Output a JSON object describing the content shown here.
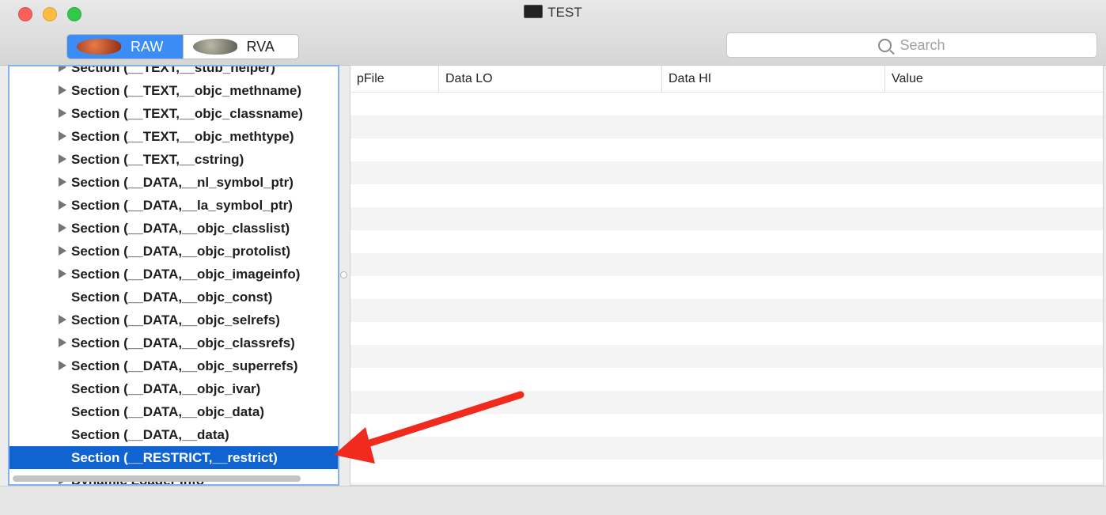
{
  "window": {
    "title": "TEST",
    "icon": "terminal-icon"
  },
  "toolbar": {
    "mode_selector": [
      {
        "label": "RAW",
        "icon": "raw-mode-icon",
        "active": true
      },
      {
        "label": "RVA",
        "icon": "rva-mode-icon",
        "active": false
      }
    ],
    "search_placeholder": "Search"
  },
  "tree": {
    "items": [
      {
        "label": "Section (__TEXT,__stub_helper)",
        "expandable": true
      },
      {
        "label": "Section (__TEXT,__objc_methname)",
        "expandable": true
      },
      {
        "label": "Section (__TEXT,__objc_classname)",
        "expandable": true
      },
      {
        "label": "Section (__TEXT,__objc_methtype)",
        "expandable": true
      },
      {
        "label": "Section (__TEXT,__cstring)",
        "expandable": true
      },
      {
        "label": "Section (__DATA,__nl_symbol_ptr)",
        "expandable": true
      },
      {
        "label": "Section (__DATA,__la_symbol_ptr)",
        "expandable": true
      },
      {
        "label": "Section (__DATA,__objc_classlist)",
        "expandable": true
      },
      {
        "label": "Section (__DATA,__objc_protolist)",
        "expandable": true
      },
      {
        "label": "Section (__DATA,__objc_imageinfo)",
        "expandable": true
      },
      {
        "label": "Section (__DATA,__objc_const)",
        "expandable": false
      },
      {
        "label": "Section (__DATA,__objc_selrefs)",
        "expandable": true
      },
      {
        "label": "Section (__DATA,__objc_classrefs)",
        "expandable": true
      },
      {
        "label": "Section (__DATA,__objc_superrefs)",
        "expandable": true
      },
      {
        "label": "Section (__DATA,__objc_ivar)",
        "expandable": false
      },
      {
        "label": "Section (__DATA,__objc_data)",
        "expandable": false
      },
      {
        "label": "Section (__DATA,__data)",
        "expandable": false
      },
      {
        "label": "Section (__RESTRICT,__restrict)",
        "expandable": false,
        "selected": true
      },
      {
        "label": "Dynamic Loader Info",
        "expandable": true
      }
    ]
  },
  "table": {
    "columns": [
      "pFile",
      "Data LO",
      "Data HI",
      "Value"
    ]
  },
  "colors": {
    "selection": "#0f64d2",
    "accent": "#3b8df5",
    "arrow": "#f02a1c"
  }
}
